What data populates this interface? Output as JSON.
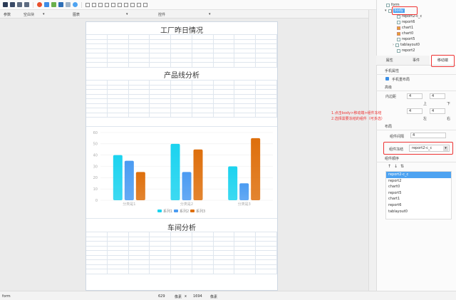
{
  "header": {
    "left_label": "参数",
    "block_label": "空白块",
    "chart_label": "图表",
    "widget_label": "控件"
  },
  "canvas": {
    "section1_title": "工厂昨日情况",
    "section2_title": "产品线分析",
    "section3_title": "车间分析"
  },
  "chart_data": {
    "type": "bar",
    "categories": [
      "分类是1",
      "分类是2",
      "分类是3"
    ],
    "series": [
      {
        "name": "系列1",
        "values": [
          40,
          50,
          30
        ],
        "color": "#1bd3ef"
      },
      {
        "name": "系列2",
        "values": [
          35,
          25,
          15
        ],
        "color": "#4a9bf2"
      },
      {
        "name": "系列3",
        "values": [
          25,
          45,
          55
        ],
        "color": "#de6f0c"
      }
    ],
    "ylim": [
      0,
      60
    ],
    "yticks": [
      "0",
      "10",
      "20",
      "30",
      "40",
      "50",
      "60"
    ],
    "grid": true,
    "legend": "bottom"
  },
  "tree": {
    "root": "form",
    "items": [
      {
        "label": "body",
        "icon": "body-icon"
      },
      {
        "label": "report2-c_c",
        "icon": "report-icon"
      },
      {
        "label": "report6",
        "icon": "report-icon"
      },
      {
        "label": "chart1",
        "icon": "chart-icon"
      },
      {
        "label": "chart0",
        "icon": "chart-icon"
      },
      {
        "label": "report5",
        "icon": "report-icon"
      },
      {
        "label": "tablayout0",
        "icon": "tablayout-icon"
      },
      {
        "label": "report2",
        "icon": "report-icon"
      }
    ]
  },
  "tabs": [
    "属性",
    "事件",
    "移动端"
  ],
  "props": {
    "mobile_attr": "手机属性",
    "mobile_layout": "手机重布局",
    "advanced": "高级",
    "padding": "内边距",
    "top": "上",
    "bottom": "下",
    "left": "左",
    "right": "右",
    "pad_top": "4",
    "pad_bottom": "4",
    "pad_left": "4",
    "pad_right": "4",
    "layout": "布局",
    "gap_label": "组件间隔",
    "gap_value": "4",
    "freeze_label": "组件冻结",
    "freeze_value": "report2-c_c",
    "order_label": "组件顺序",
    "order_items": [
      "report2-c_c",
      "report2",
      "chart0",
      "report5",
      "chart1",
      "report6",
      "tablayout0"
    ]
  },
  "annotation": {
    "line1": "1.点击body>移动端>组件冻结",
    "line2": "2.选择需要冻结的组件（可多选）"
  },
  "status": {
    "name": "form",
    "width": "629",
    "unit1": "像素",
    "times": "x",
    "height": "1694",
    "unit2": "像素"
  },
  "colors": {
    "accent": "#4ea3f1",
    "annotation": "#e33333"
  }
}
